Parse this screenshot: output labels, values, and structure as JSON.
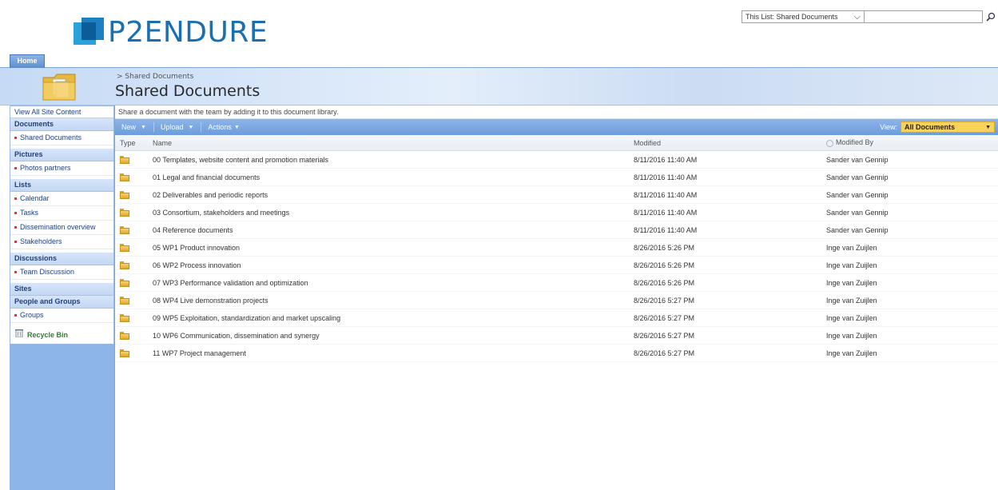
{
  "brand": {
    "logo_text": "P2ENDURE",
    "logo_color": "#1a6fb0"
  },
  "search": {
    "scope": "This List: Shared Documents",
    "value": "",
    "icon": "search-icon"
  },
  "topnav": {
    "home_tab": "Home"
  },
  "title_area": {
    "breadcrumb": "> Shared Documents",
    "title": "Shared Documents"
  },
  "leftnav": {
    "view_all": "View All Site Content",
    "sections": [
      {
        "heading": "Documents",
        "items": [
          "Shared Documents"
        ]
      },
      {
        "heading": "Pictures",
        "items": [
          "Photos partners"
        ]
      },
      {
        "heading": "Lists",
        "items": [
          "Calendar",
          "Tasks",
          "Dissemination overview",
          "Stakeholders"
        ]
      },
      {
        "heading": "Discussions",
        "items": [
          "Team Discussion"
        ]
      },
      {
        "heading": "Sites",
        "items": []
      },
      {
        "heading": "People and Groups",
        "items": [
          "Groups"
        ]
      }
    ],
    "recycle_bin": "Recycle Bin"
  },
  "main": {
    "description": "Share a document with the team by adding it to this document library.",
    "toolbar": {
      "new": "New",
      "upload": "Upload",
      "actions": "Actions",
      "view_label": "View:",
      "view_value": "All Documents"
    },
    "columns": {
      "type": "Type",
      "name": "Name",
      "modified": "Modified",
      "modified_by": "Modified By"
    },
    "rows": [
      {
        "name": "00 Templates, website content and promotion materials",
        "modified": "8/11/2016 11:40 AM",
        "by": "Sander van Gennip"
      },
      {
        "name": "01 Legal and financial documents",
        "modified": "8/11/2016 11:40 AM",
        "by": "Sander van Gennip"
      },
      {
        "name": "02 Deliverables and periodic reports",
        "modified": "8/11/2016 11:40 AM",
        "by": "Sander van Gennip"
      },
      {
        "name": "03 Consortium, stakeholders and meetings",
        "modified": "8/11/2016 11:40 AM",
        "by": "Sander van Gennip"
      },
      {
        "name": "04 Reference documents",
        "modified": "8/11/2016 11:40 AM",
        "by": "Sander van Gennip"
      },
      {
        "name": "05 WP1 Product innovation",
        "modified": "8/26/2016 5:26 PM",
        "by": "Inge van Zuijlen"
      },
      {
        "name": "06 WP2 Process innovation",
        "modified": "8/26/2016 5:26 PM",
        "by": "Inge van Zuijlen"
      },
      {
        "name": "07 WP3 Performance validation and optimization",
        "modified": "8/26/2016 5:26 PM",
        "by": "Inge van Zuijlen"
      },
      {
        "name": "08 WP4 Live demonstration projects",
        "modified": "8/26/2016 5:27 PM",
        "by": "Inge van Zuijlen"
      },
      {
        "name": "09 WP5 Exploitation, standardization and market upscaling",
        "modified": "8/26/2016 5:27 PM",
        "by": "Inge van Zuijlen"
      },
      {
        "name": "10 WP6 Communication, dissemination and synergy",
        "modified": "8/26/2016 5:27 PM",
        "by": "Inge van Zuijlen"
      },
      {
        "name": "11 WP7 Project management",
        "modified": "8/26/2016 5:27 PM",
        "by": "Inge van Zuijlen"
      }
    ]
  }
}
